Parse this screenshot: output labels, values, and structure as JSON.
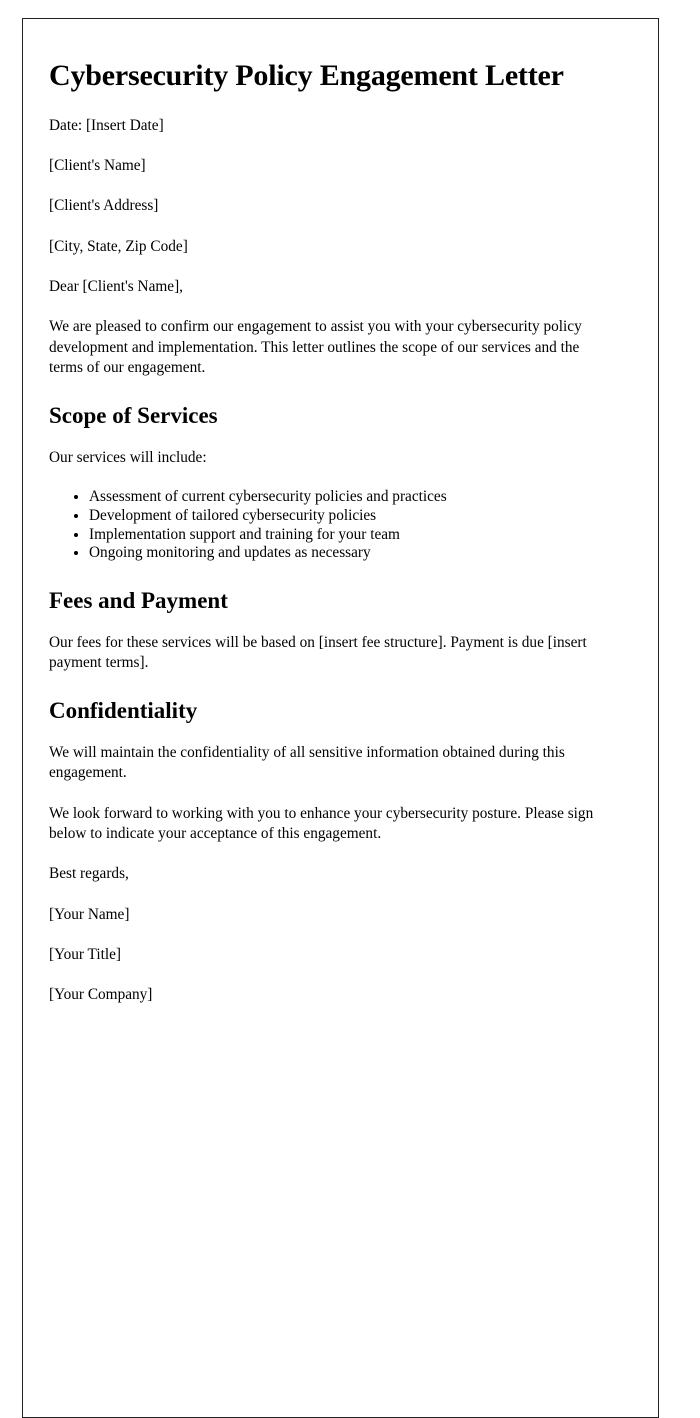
{
  "document": {
    "title": "Cybersecurity Policy Engagement Letter",
    "date_line": "Date: [Insert Date]",
    "recipient": {
      "name": "[Client's Name]",
      "address": "[Client's Address]",
      "city_state_zip": "[City, State, Zip Code]"
    },
    "salutation": "Dear [Client's Name],",
    "intro_paragraph": "We are pleased to confirm our engagement to assist you with your cybersecurity policy development and implementation. This letter outlines the scope of our services and the terms of our engagement.",
    "sections": {
      "scope": {
        "heading": "Scope of Services",
        "lead_in": "Our services will include:",
        "items": [
          "Assessment of current cybersecurity policies and practices",
          "Development of tailored cybersecurity policies",
          "Implementation support and training for your team",
          "Ongoing monitoring and updates as necessary"
        ]
      },
      "fees": {
        "heading": "Fees and Payment",
        "paragraph": "Our fees for these services will be based on [insert fee structure]. Payment is due [insert payment terms]."
      },
      "confidentiality": {
        "heading": "Confidentiality",
        "paragraph": "We will maintain the confidentiality of all sensitive information obtained during this engagement."
      }
    },
    "closing_paragraph": "We look forward to working with you to enhance your cybersecurity posture. Please sign below to indicate your acceptance of this engagement.",
    "signature_block": {
      "valediction": "Best regards,",
      "name": "[Your Name]",
      "title": "[Your Title]",
      "company": "[Your Company]"
    }
  },
  "colors": {
    "page_background": "#ffffff",
    "text": "#000000",
    "page_border": "#222222"
  }
}
